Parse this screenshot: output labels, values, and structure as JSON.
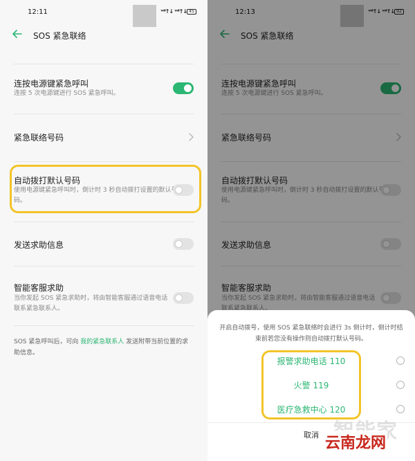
{
  "left_screen": {
    "status_time": "12:11",
    "signal_1": "ᵛᵒˡ↑↓",
    "signal_2": "ᵛᵒˡ↑↓",
    "battery": "45",
    "page_title": "SOS 紧急联络",
    "rows": [
      {
        "title": "连按电源键紧急呼叫",
        "subtitle": "连按 5 次电源键进行 SOS 紧急呼叫。",
        "toggle": "on"
      },
      {
        "title": "紧急联络号码",
        "subtitle": "",
        "toggle": "chevron"
      },
      {
        "title": "自动拨打默认号码",
        "subtitle": "使用电源键紧急呼叫时，倒计时 3 秒自动拨打设置的默认号码。",
        "toggle": "off"
      },
      {
        "title": "发送求助信息",
        "subtitle": "",
        "toggle": "off"
      },
      {
        "title": "智能客服求助",
        "subtitle": "当你发起 SOS 紧急求助时，将由智能客服通过语音电话联系紧急联系人。",
        "toggle": "off"
      }
    ],
    "footer_pre": "SOS 紧急呼叫后，可向 ",
    "footer_link": "我的紧急联系人",
    "footer_post": " 发送附带当前位置的求助信息。"
  },
  "right_screen": {
    "status_time": "12:13",
    "signal_1": "ᵛᵒˡ↑↓",
    "signal_2": "ᵛᵒˡ↑↓",
    "battery": "92",
    "page_title": "SOS 紧急联络",
    "rows": [
      {
        "title": "连按电源键紧急呼叫",
        "subtitle": "连按 5 次电源键进行 SOS 紧急呼叫。"
      },
      {
        "title": "紧急联络号码",
        "subtitle": ""
      },
      {
        "title": "自动拨打默认号码",
        "subtitle": "使用电源键紧急呼叫时，倒计时 3 秒自动拨打设置的默认号码。"
      },
      {
        "title": "发送求助信息",
        "subtitle": ""
      },
      {
        "title": "智能客服求助",
        "subtitle": "当你发起 SOS 紧急求助时，将由智能客服通过语音电话联系紧急联系人。"
      }
    ],
    "sheet": {
      "description": "开启自动拨号，使用 SOS 紧急联络时会进行 3s 倒计时，倒计时结束前若您没有操作则自动拨打默认号码。",
      "options": [
        {
          "label": "报警求助电话 110"
        },
        {
          "label": "火警 119"
        },
        {
          "label": "医疗急救中心 120"
        }
      ],
      "cancel_label": "取消"
    }
  },
  "watermark": {
    "text_1": "智能家",
    "text_2": "云南龙网"
  },
  "colors": {
    "accent_green": "#2bb673",
    "highlight_yellow": "#f3c428"
  }
}
